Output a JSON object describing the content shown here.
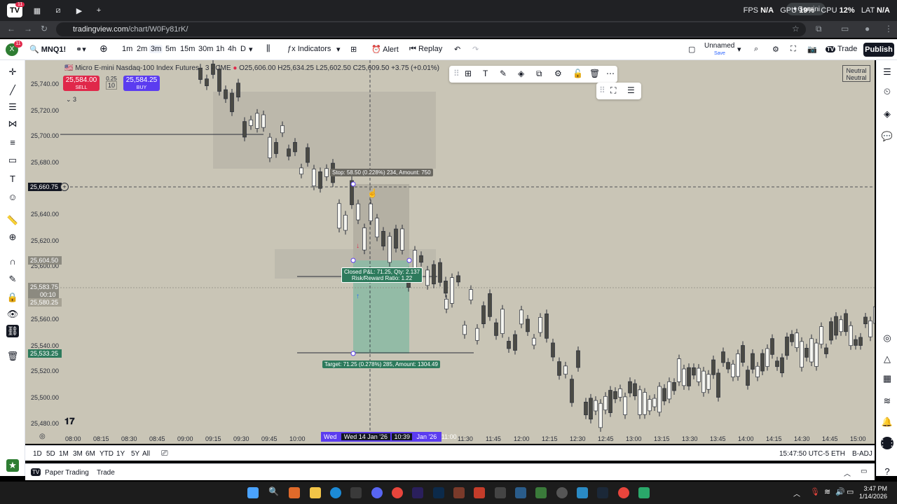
{
  "browser": {
    "url_host": "tradingview.com",
    "url_path": "/chart/W0Fy81rK/",
    "notification_badge": "11",
    "gemini_label": "Gemini",
    "stats": {
      "fps_label": "FPS",
      "fps": "N/A",
      "gpu_label": "GPU",
      "gpu": "19%",
      "cpu_label": "CPU",
      "cpu": "12%",
      "lat_label": "LAT",
      "lat": "N/A"
    }
  },
  "toolbar": {
    "symbol": "MNQ1!",
    "timeframes": [
      "1m",
      "2m",
      "3m",
      "5m",
      "15m",
      "30m",
      "1h",
      "4h",
      "D"
    ],
    "active_timeframe": "3m",
    "indicators_label": "Indicators",
    "alert_label": "Alert",
    "replay_label": "Replay",
    "layout_name": "Unnamed",
    "layout_save": "Save",
    "trade_label": "Trade",
    "publish_label": "Publish"
  },
  "chart": {
    "symbol_title": "Micro E-mini Nasdaq-100 Index Futures · 3 · CME",
    "ohlc": {
      "o": "25,606.00",
      "h": "25,634.25",
      "l": "25,602.50",
      "c": "25,609.50",
      "change": "+3.75 (+0.01%)"
    },
    "sell_price": "25,584.00",
    "sell_label": "SELL",
    "buy_price": "25,584.25",
    "buy_label": "BUY",
    "spread": "0.25",
    "quantity": "10",
    "indicator_count": "3",
    "neutral_line1": "Neutral",
    "neutral_line2": "Neutral",
    "price_levels": [
      "25,740.00",
      "25,720.00",
      "25,700.00",
      "25,680.00",
      "25,640.00",
      "25,620.00",
      "25,600.00",
      "25,560.00",
      "25,540.00",
      "25,520.00",
      "25,500.00",
      "25,480.00"
    ],
    "price_tags": {
      "crosshair": "25,660.75",
      "entry": "25,604.50",
      "last": "25,583.75",
      "countdown": "00:10",
      "prev": "25,580.25",
      "target": "25,533.25"
    },
    "time_labels": [
      "08:00",
      "08:15",
      "08:30",
      "08:45",
      "09:00",
      "09:15",
      "09:30",
      "09:45",
      "10:00",
      "11:30",
      "11:45",
      "12:00",
      "12:15",
      "12:30",
      "12:45",
      "13:00",
      "13:15",
      "13:30",
      "13:45",
      "14:00",
      "14:15",
      "14:30",
      "14:45",
      "15:00"
    ],
    "time_tag": {
      "day": "Wed",
      "date": "Wed 14 Jan '26",
      "time": "10:39",
      "next": "Jan '26",
      "next_time": "11:00"
    },
    "stop_label": "Stop: 58.50 (0.228%) 234, Amount: 750",
    "pnl_line1": "Closed P&L: 71.25, Qty: 2.137",
    "pnl_line2": "Risk/Reward Ratio: 1.22",
    "target_label": "Target: 71.25 (0.278%) 285, Amount: 1304.49"
  },
  "bottom": {
    "ranges": [
      "1D",
      "5D",
      "1M",
      "3M",
      "6M",
      "YTD",
      "1Y",
      "5Y",
      "All"
    ],
    "clock": "15:47:50 UTC-5",
    "session": "ETH",
    "adjust": "B-ADJ",
    "paper_trading": "Paper Trading",
    "trade": "Trade"
  },
  "taskbar": {
    "time": "3:47 PM",
    "date": "1/14/2026"
  }
}
